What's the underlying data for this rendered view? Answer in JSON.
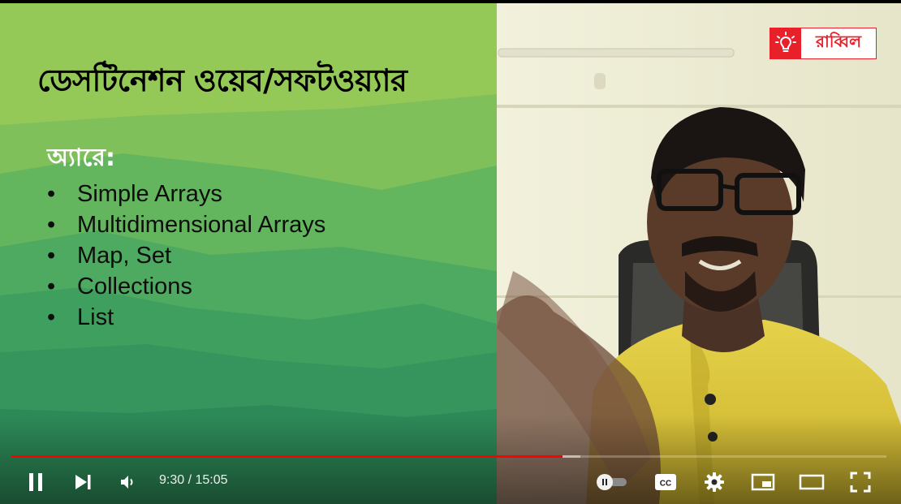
{
  "slide": {
    "title": "ডেসটিনেশন ওয়েব/সফটওয়্যার",
    "subtitle": "অ্যারে:",
    "bullets": [
      "Simple Arrays",
      "Multidimensional Arrays",
      "Map, Set",
      "Collections",
      "List"
    ],
    "bullet_char": "•"
  },
  "logo": {
    "text": "রাব্বিল",
    "icon": "lightbulb-icon",
    "color": "#e8202a"
  },
  "player": {
    "current_time": "9:30",
    "separator": " / ",
    "duration": "15:05",
    "played_fraction": 0.63,
    "loaded_fraction": 0.65,
    "progress_color": "#ff0000",
    "autoplay_on": false,
    "icons": {
      "play_pause": "pause-icon",
      "next": "next-icon",
      "volume": "volume-icon",
      "autoplay": "autoplay-toggle-icon",
      "captions": "cc-icon",
      "settings": "gear-icon",
      "miniplayer": "miniplayer-icon",
      "theater": "theater-mode-icon",
      "fullscreen": "fullscreen-icon"
    }
  }
}
